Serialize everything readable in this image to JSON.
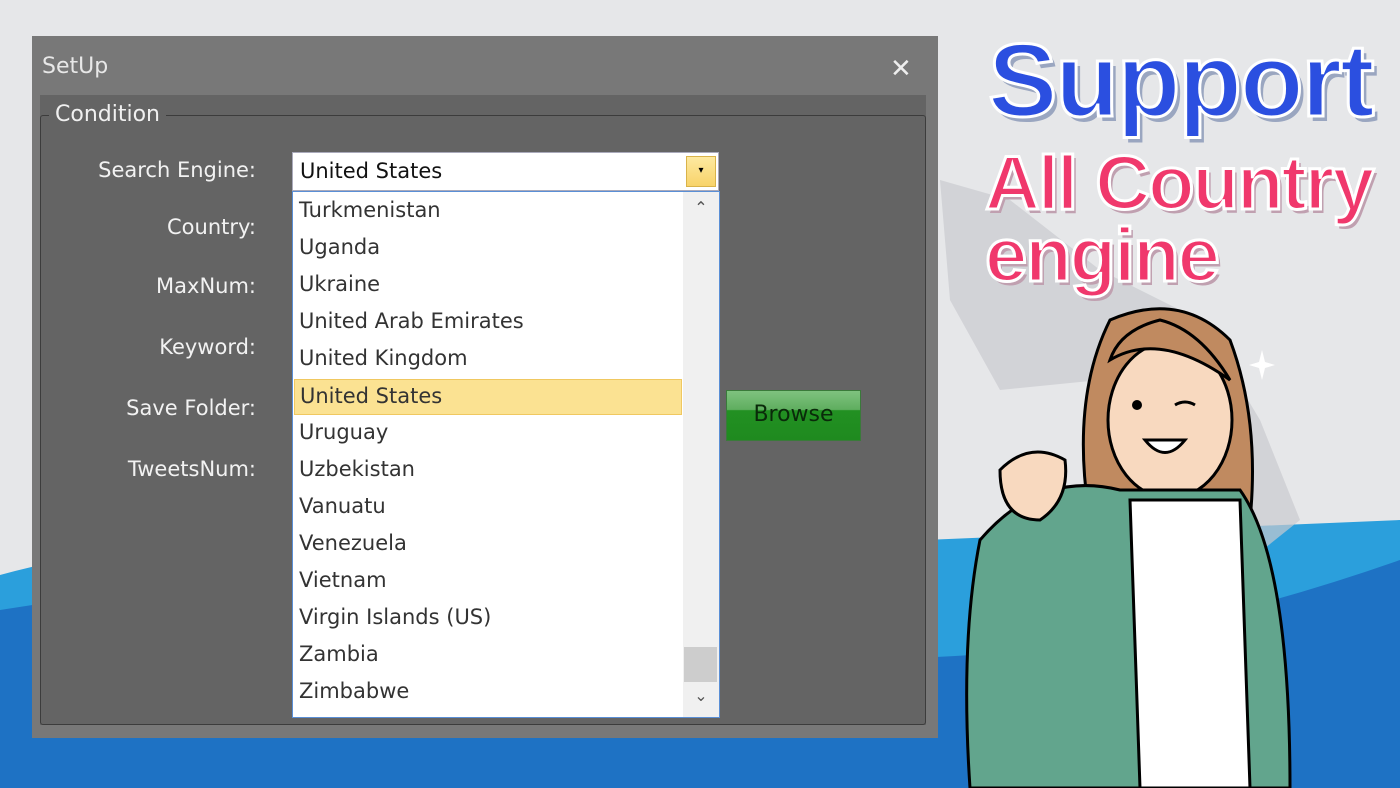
{
  "window": {
    "title": "SetUp",
    "close_icon": "close-icon"
  },
  "group": {
    "label": "Condition"
  },
  "labels": [
    "Search Engine:",
    "Country:",
    "MaxNum:",
    "Keyword:",
    "Save Folder:",
    "TweetsNum:"
  ],
  "combo": {
    "value": "United States"
  },
  "dropdown": {
    "items": [
      "Turkmenistan",
      "Uganda",
      "Ukraine",
      "United Arab Emirates",
      "United Kingdom",
      "United States",
      "Uruguay",
      "Uzbekistan",
      "Vanuatu",
      "Venezuela",
      "Vietnam",
      "Virgin Islands (US)",
      "Zambia",
      "Zimbabwe"
    ],
    "selected": "United States"
  },
  "browse": {
    "label": "Browse"
  },
  "promo": {
    "line1": "Support",
    "line2": "All Country",
    "line3": "engine"
  },
  "colors": {
    "highlight": "#fbe292",
    "browse": "#1f8a1f",
    "promo_blue": "#2b4fe0",
    "promo_pink": "#f0386c",
    "wave": "#1e72c4"
  }
}
